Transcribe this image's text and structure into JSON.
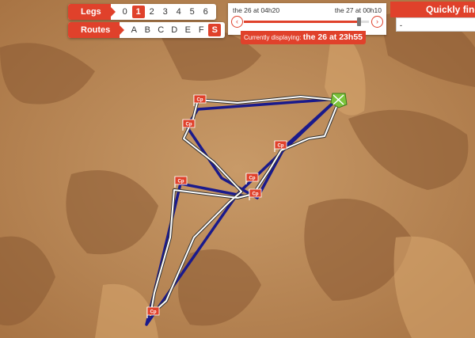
{
  "legs": {
    "label": "Legs",
    "options": [
      "0",
      "1",
      "2",
      "3",
      "4",
      "5",
      "6"
    ],
    "active": "1"
  },
  "routes": {
    "label": "Routes",
    "options": [
      "A",
      "B",
      "C",
      "D",
      "E",
      "F",
      "S"
    ],
    "active": "S"
  },
  "timeline": {
    "start_label": "the 26 at 04h20",
    "end_label": "the 27 at 00h10",
    "progress": 0.92,
    "prev_icon": "chevron-left-icon",
    "next_icon": "chevron-right-icon"
  },
  "display": {
    "prefix": "Currently displaying:",
    "value": "the 26 at 23h55"
  },
  "quick_find": {
    "title": "Quickly find a",
    "value": "-"
  },
  "checkpoint_label": "Cp",
  "colors": {
    "accent": "#e0412b",
    "route": "#1a1a8c",
    "track": "#ffffff"
  }
}
